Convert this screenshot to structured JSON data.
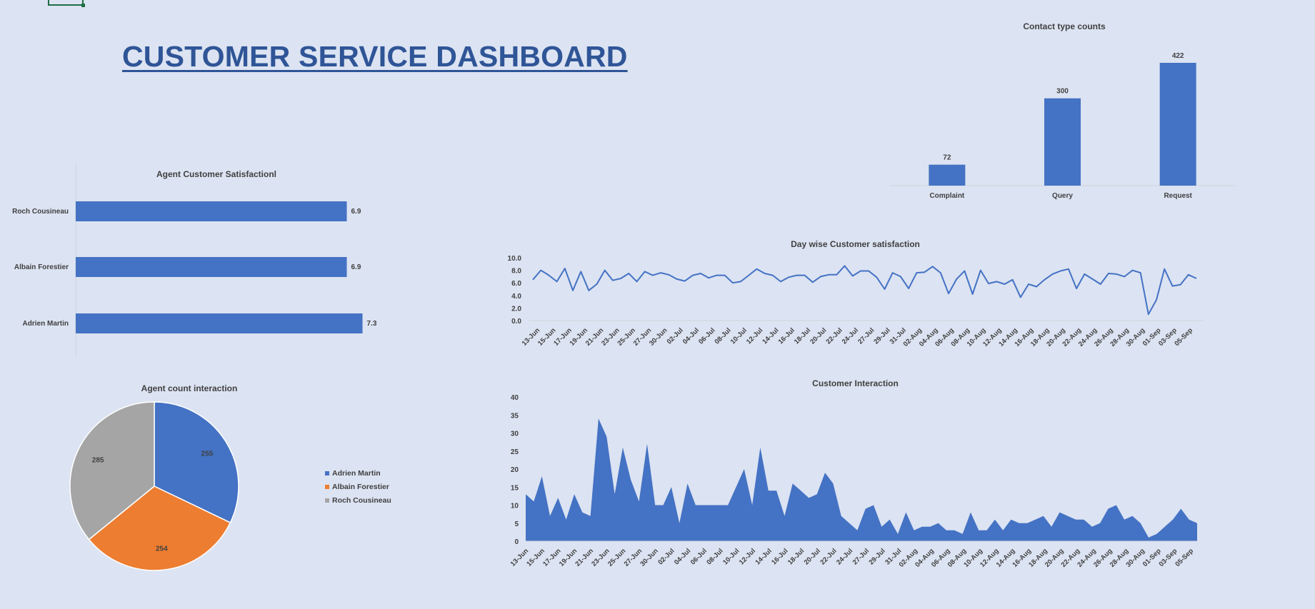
{
  "dashboard": {
    "title": "CUSTOMER SERVICE DASHBOARD"
  },
  "colors": {
    "accent": "#4472c4",
    "orange": "#ed7d31",
    "gray": "#a5a5a5",
    "title": "#2f5597",
    "background": "#dce3f2"
  },
  "chart_data": [
    {
      "id": "contact-type",
      "type": "bar",
      "title": "Contact type counts",
      "categories": [
        "Complaint",
        "Query",
        "Request"
      ],
      "values": [
        72,
        300,
        422
      ],
      "data_labels": true,
      "ylim": [
        0,
        422
      ],
      "grid": false
    },
    {
      "id": "agent-satisfaction",
      "type": "bar",
      "orientation": "horizontal",
      "title": "Agent Customer Satisfactionl",
      "categories": [
        "Roch Cousineau",
        "Albain Forestier",
        "Adrien Martin"
      ],
      "values": [
        6.9,
        6.9,
        7.3
      ],
      "data_labels": true,
      "xlim": [
        0,
        8
      ],
      "grid": false
    },
    {
      "id": "agent-interaction",
      "type": "pie",
      "title": "Agent count interaction",
      "categories": [
        "Adrien Martin",
        "Albain Forestier",
        "Roch Cousineau"
      ],
      "values": [
        255,
        254,
        285
      ],
      "colors": [
        "#4472c4",
        "#ed7d31",
        "#a5a5a5"
      ],
      "legend": "right"
    },
    {
      "id": "daywise-satisfaction",
      "type": "line",
      "title": "Day wise Customer satisfaction",
      "ylim": [
        0,
        10
      ],
      "yticks": [
        "10.0",
        "8.0",
        "6.0",
        "4.0",
        "2.0",
        "0.0"
      ],
      "xticks": [
        "13-Jun",
        "15-Jun",
        "17-Jun",
        "19-Jun",
        "21-Jun",
        "23-Jun",
        "25-Jun",
        "27-Jun",
        "30-Jun",
        "02-Jul",
        "04-Jul",
        "06-Jul",
        "08-Jul",
        "10-Jul",
        "12-Jul",
        "14-Jul",
        "16-Jul",
        "18-Jul",
        "20-Jul",
        "22-Jul",
        "24-Jul",
        "27-Jul",
        "29-Jul",
        "31-Jul",
        "02-Aug",
        "04-Aug",
        "06-Aug",
        "08-Aug",
        "10-Aug",
        "12-Aug",
        "14-Aug",
        "16-Aug",
        "18-Aug",
        "20-Aug",
        "22-Aug",
        "24-Aug",
        "26-Aug",
        "28-Aug",
        "30-Aug",
        "01-Sep",
        "03-Sep",
        "05-Sep"
      ],
      "values": [
        6.5,
        8.0,
        7.2,
        6.2,
        8.3,
        4.8,
        7.8,
        4.8,
        5.8,
        8.0,
        6.4,
        6.7,
        7.5,
        6.2,
        7.8,
        7.2,
        7.6,
        7.3,
        6.6,
        6.3,
        7.2,
        7.5,
        6.8,
        7.2,
        7.2,
        6.0,
        6.2,
        7.2,
        8.2,
        7.5,
        7.2,
        6.2,
        6.9,
        7.2,
        7.2,
        6.1,
        7.0,
        7.3,
        7.3,
        8.7,
        7.1,
        7.9,
        7.9,
        6.9,
        5.0,
        7.6,
        7.0,
        5.1,
        7.6,
        7.7,
        8.6,
        7.6,
        4.3,
        6.6,
        7.9,
        4.2,
        8.0,
        5.9,
        6.2,
        5.8,
        6.5,
        3.7,
        5.8,
        5.4,
        6.5,
        7.4,
        7.9,
        8.2,
        5.1,
        7.4,
        6.6,
        5.8,
        7.5,
        7.4,
        7.0,
        8.0,
        7.6,
        1.0,
        3.3,
        8.2,
        5.5,
        5.7,
        7.3,
        6.7
      ],
      "grid": false
    },
    {
      "id": "customer-interaction",
      "type": "area",
      "title": "Customer Interaction",
      "ylim": [
        0,
        40
      ],
      "yticks": [
        "40",
        "35",
        "30",
        "25",
        "20",
        "15",
        "10",
        "5",
        "0"
      ],
      "xticks": [
        "13-Jun",
        "15-Jun",
        "17-Jun",
        "19-Jun",
        "21-Jun",
        "23-Jun",
        "25-Jun",
        "27-Jun",
        "30-Jun",
        "02-Jul",
        "04-Jul",
        "06-Jul",
        "08-Jul",
        "10-Jul",
        "12-Jul",
        "14-Jul",
        "16-Jul",
        "18-Jul",
        "20-Jul",
        "22-Jul",
        "24-Jul",
        "27-Jul",
        "29-Jul",
        "31-Jul",
        "02-Aug",
        "04-Aug",
        "06-Aug",
        "08-Aug",
        "10-Aug",
        "12-Aug",
        "14-Aug",
        "16-Aug",
        "18-Aug",
        "20-Aug",
        "22-Aug",
        "24-Aug",
        "26-Aug",
        "28-Aug",
        "30-Aug",
        "01-Sep",
        "03-Sep",
        "05-Sep"
      ],
      "values": [
        13,
        11,
        18,
        7,
        12,
        6,
        13,
        8,
        7,
        34,
        29,
        13,
        26,
        17,
        11,
        27,
        10,
        10,
        15,
        5,
        16,
        10,
        10,
        10,
        10,
        10,
        15,
        20,
        10,
        26,
        14,
        14,
        7,
        16,
        14,
        12,
        13,
        19,
        16,
        7,
        5,
        3,
        9,
        10,
        4,
        6,
        2,
        8,
        3,
        4,
        4,
        5,
        3,
        3,
        2,
        8,
        3,
        3,
        6,
        3,
        6,
        5,
        5,
        6,
        7,
        4,
        8,
        7,
        6,
        6,
        4,
        5,
        9,
        10,
        6,
        7,
        5,
        1,
        2,
        4,
        6,
        9,
        6,
        5
      ],
      "grid": false
    }
  ]
}
